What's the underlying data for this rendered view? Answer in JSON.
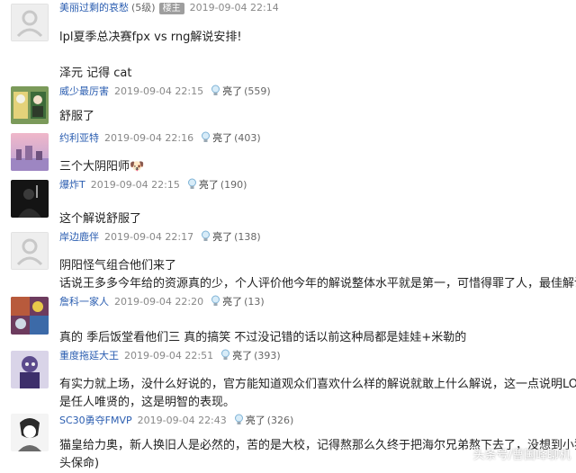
{
  "posts": [
    {
      "user": "美丽过剩的哀愁",
      "level": "(5级)",
      "badge": "楼主",
      "time": "2019-09-04 22:14",
      "lines": [
        "lpl夏季总决赛fpx vs rng解说安排!",
        "",
        "泽元 记得 cat"
      ]
    },
    {
      "user": "威少最厉害",
      "time": "2019-09-04 22:15",
      "like": "亮了",
      "count": "(559)",
      "lines": [
        "舒服了"
      ]
    },
    {
      "user": "约利亚特",
      "time": "2019-09-04 22:16",
      "like": "亮了",
      "count": "(403)",
      "lines": [
        "三个大阴阳师🐶"
      ]
    },
    {
      "user": "爆炸T",
      "time": "2019-09-04 22:15",
      "like": "亮了",
      "count": "(190)",
      "lines": [
        "这个解说舒服了"
      ]
    },
    {
      "user": "岸边鹿伴",
      "time": "2019-09-04 22:17",
      "like": "亮了",
      "count": "(138)",
      "lines": [
        "阴阳怪气组合他们来了",
        "话说王多多今年给的资源真的少，个人评价他今年的解说整体水平就是第一，可惜得罪了人，最佳解说"
      ]
    },
    {
      "user": "詹科一家人",
      "time": "2019-09-04 22:20",
      "like": "亮了",
      "count": "(13)",
      "lines": [
        "真的 季后饭堂看他们三 真的搞笑 不过没记错的话以前这种局都是娃娃+米勒的"
      ]
    },
    {
      "user": "重度拖延大王",
      "time": "2019-09-04 22:51",
      "like": "亮了",
      "count": "(393)",
      "lines": [
        "有实力就上场，没什么好说的，官方能知道观众们喜欢什么样的解说就敢上什么解说，这一点说明LOL官",
        "是任人唯贤的，这是明智的表现。"
      ]
    },
    {
      "user": "SC30勇夺FMVP",
      "time": "2019-09-04 22:43",
      "like": "亮了",
      "count": "(326)",
      "lines": [
        "猫皇给力奥，新人换旧人是必然的，苦的是大校，记得熬那么久终于把海尔兄弟熬下去了，没想到小猫",
        "头保命)"
      ]
    }
  ],
  "watermark": "头条号/曹国峰聊机",
  "colors": {
    "username": "#2a5db0",
    "time": "#888888",
    "badge": "#9e9e9e"
  }
}
